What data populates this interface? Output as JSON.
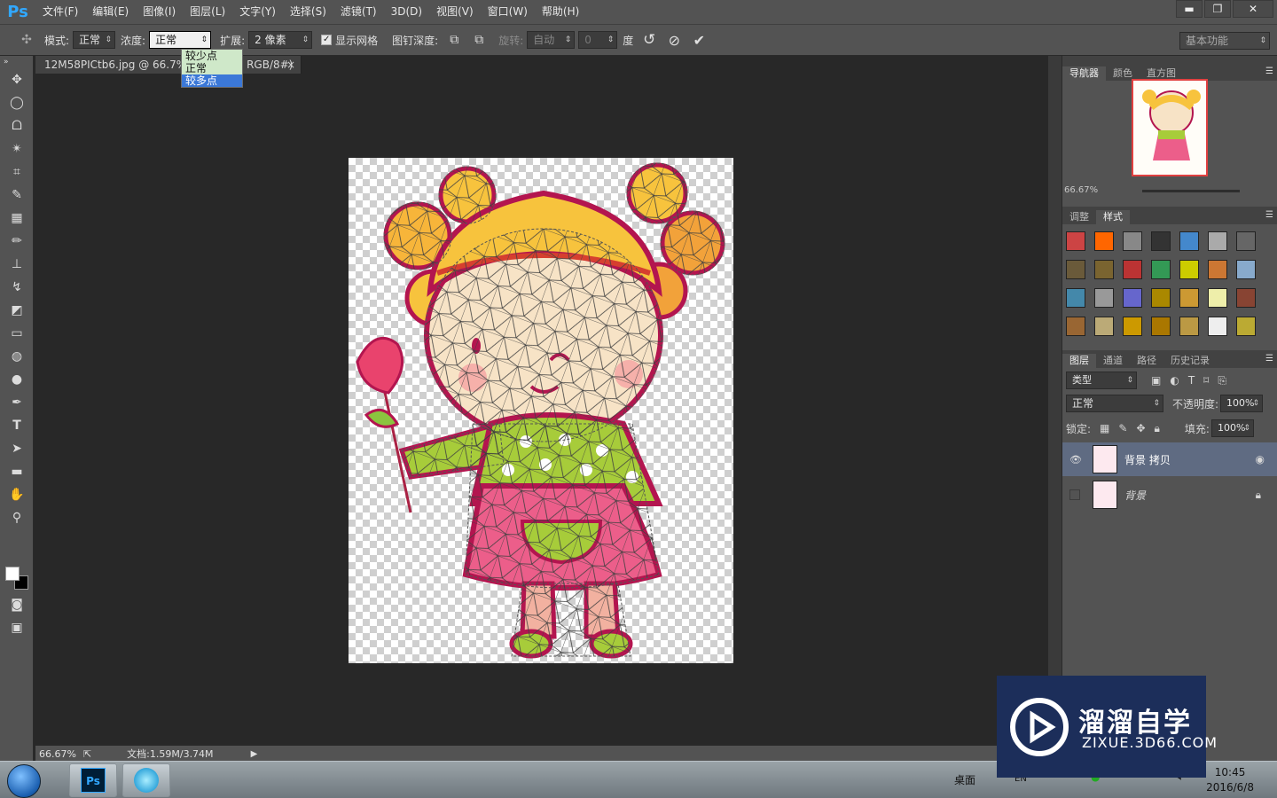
{
  "app": {
    "logo": "Ps"
  },
  "menu": [
    "文件(F)",
    "编辑(E)",
    "图像(I)",
    "图层(L)",
    "文字(Y)",
    "选择(S)",
    "滤镜(T)",
    "3D(D)",
    "视图(V)",
    "窗口(W)",
    "帮助(H)"
  ],
  "window_controls": {
    "minimize": "▬",
    "restore": "❐",
    "close": "✕"
  },
  "options": {
    "mode_label": "模式:",
    "mode_value": "正常",
    "density_label": "浓度:",
    "density_value": "正常",
    "expand_label": "扩展:",
    "expand_value": "2 像素",
    "show_mesh_label": "显示网格",
    "pin_depth_label": "图钉深度:",
    "rotate_label": "旋转:",
    "rotate_value": "自动",
    "angle_value": "0",
    "degree_label": "度",
    "workspace": "基本功能"
  },
  "density_dropdown": {
    "items": [
      "较少点",
      "正常",
      "较多点"
    ],
    "selected_index": 2
  },
  "document_tab": {
    "title": "12M58PICtb6.jpg @ 66.7% (背景 拷贝, RGB/8#) *",
    "close": "×"
  },
  "status": {
    "zoom": "66.67%",
    "doc": "文档:1.59M/3.74M",
    "arrow": "▶"
  },
  "navigator": {
    "tabs": [
      "导航器",
      "颜色",
      "直方图"
    ],
    "zoom": "66.67%"
  },
  "styles_panel": {
    "tabs": [
      "调整",
      "样式"
    ],
    "active": 1
  },
  "layers_panel": {
    "tabs": [
      "图层",
      "通道",
      "路径",
      "历史记录"
    ],
    "filter": "类型",
    "blend_mode": "正常",
    "opacity_label": "不透明度:",
    "opacity_value": "100%",
    "lock_label": "锁定:",
    "fill_label": "填充:",
    "fill_value": "100%",
    "layers": [
      {
        "name": "背景 拷贝",
        "visible": true,
        "selected": true
      },
      {
        "name": "背景",
        "visible": false,
        "selected": false,
        "locked": true
      }
    ]
  },
  "taskbar": {
    "desktop_label": "桌面",
    "lang": "EN",
    "time": "10:45",
    "date": "2016/6/8"
  },
  "watermark": {
    "title": "溜溜自学",
    "subtitle": "ZIXUE.3D66.COM"
  },
  "colors": {
    "panel": "#535353",
    "dark": "#282828",
    "accent": "#31a8ff",
    "selection": "#3b78d8",
    "watermark_bg": "#1c2e5a"
  }
}
